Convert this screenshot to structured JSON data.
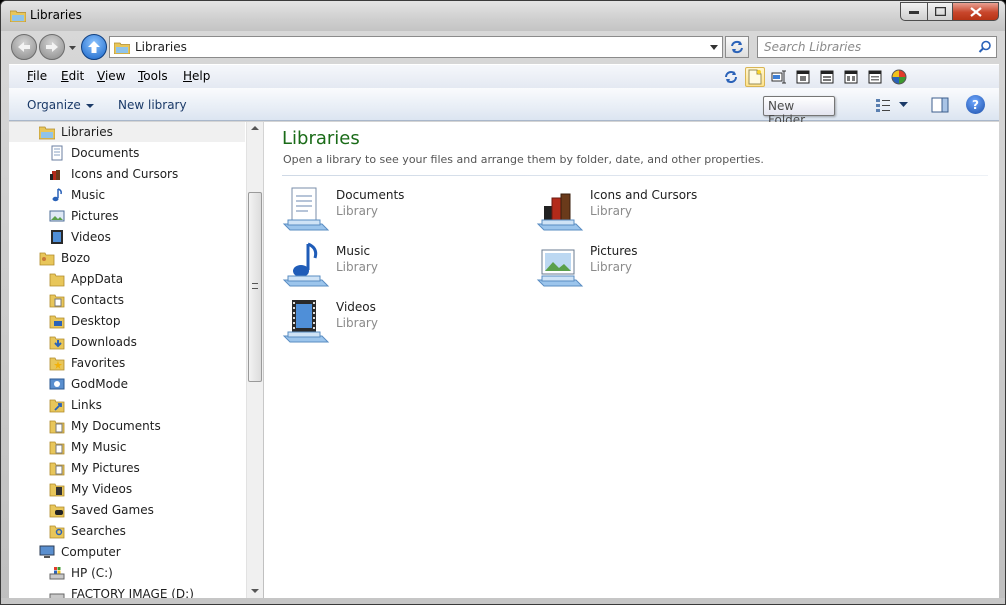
{
  "window": {
    "title": "Libraries"
  },
  "address_bar": {
    "path": "Libraries",
    "search_placeholder": "Search Libraries"
  },
  "menu": {
    "file": {
      "accel": "F",
      "rest": "ile"
    },
    "edit": {
      "accel": "E",
      "rest": "dit"
    },
    "view": {
      "accel": "V",
      "rest": "iew"
    },
    "tools": {
      "accel": "T",
      "rest": "ools"
    },
    "help": {
      "accel": "H",
      "rest": "elp"
    }
  },
  "command_bar": {
    "organize": "Organize",
    "new_library": "New library",
    "tooltip": "New Folder"
  },
  "nav_tree": {
    "libraries": "Libraries",
    "lib_children": [
      "Documents",
      "Icons and Cursors",
      "Music",
      "Pictures",
      "Videos"
    ],
    "user": "Bozo",
    "user_children": [
      "AppData",
      "Contacts",
      "Desktop",
      "Downloads",
      "Favorites",
      "GodMode",
      "Links",
      "My Documents",
      "My Music",
      "My Pictures",
      "My Videos",
      "Saved Games",
      "Searches"
    ],
    "computer": "Computer",
    "drives": [
      "HP (C:)",
      "FACTORY IMAGE (D:)"
    ]
  },
  "main": {
    "title": "Libraries",
    "subtitle": "Open a library to see your files and arrange them by folder, date, and other properties.",
    "libraries": [
      {
        "name": "Documents",
        "type": "Library"
      },
      {
        "name": "Icons and Cursors",
        "type": "Library"
      },
      {
        "name": "Music",
        "type": "Library"
      },
      {
        "name": "Pictures",
        "type": "Library"
      },
      {
        "name": "Videos",
        "type": "Library"
      }
    ]
  },
  "colors": {
    "title_green": "#1a6b18",
    "command_text": "#1b3a68",
    "close_red": "#c8462b"
  }
}
